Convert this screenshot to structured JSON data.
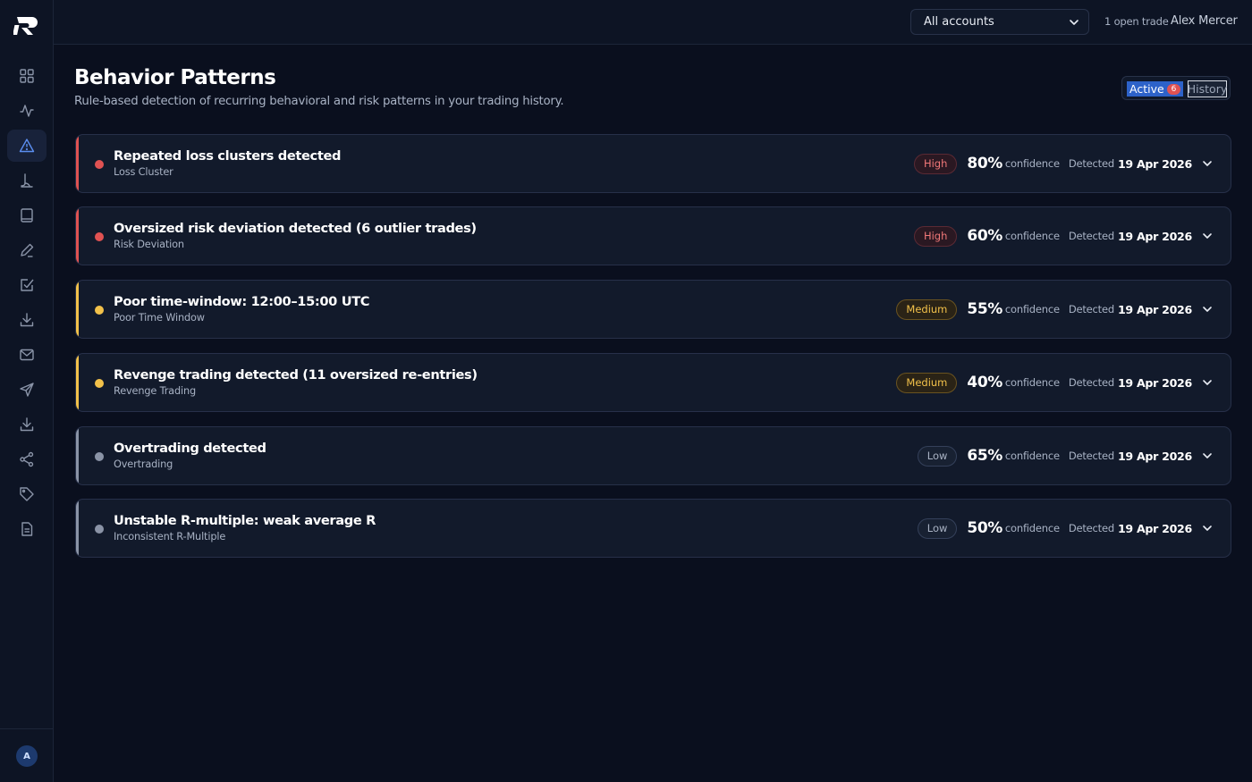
{
  "colors": {
    "high": "#e05252",
    "medium": "#f2c14a",
    "low": "#8a93a6",
    "accent": "#2d62c9"
  },
  "sidebar": {
    "logo": "R",
    "items": [
      {
        "icon": "dashboard-grid-icon",
        "active": false
      },
      {
        "icon": "activity-pulse-icon",
        "active": false
      },
      {
        "icon": "warning-triangle-icon",
        "active": true
      },
      {
        "icon": "lamp-icon",
        "active": false
      },
      {
        "icon": "book-icon",
        "active": false
      },
      {
        "icon": "pen-icon",
        "active": false
      },
      {
        "icon": "checkbox-icon",
        "active": false
      },
      {
        "icon": "download-icon",
        "active": false
      },
      {
        "icon": "mail-icon",
        "active": false
      },
      {
        "icon": "send-icon",
        "active": false
      },
      {
        "icon": "import-icon",
        "active": false
      },
      {
        "icon": "share-icon",
        "active": false
      },
      {
        "icon": "tag-icon",
        "active": false
      },
      {
        "icon": "document-icon",
        "active": false
      }
    ],
    "avatar_initial": "A"
  },
  "topbar": {
    "account_select": "All accounts",
    "open_trade": "1 open trade",
    "user_name": "Alex Mercer"
  },
  "header": {
    "title": "Behavior Patterns",
    "subtitle": "Rule-based detection of recurring behavioral and risk patterns in your trading history.",
    "toggle": {
      "active_label": "Active",
      "active_count": "6",
      "history_label": "History"
    }
  },
  "patterns": [
    {
      "title": "Repeated loss clusters detected",
      "category": "Loss Cluster",
      "severity": "High",
      "severity_key": "high",
      "confidence": "80%",
      "confidence_label": "confidence",
      "detected_label": "Detected",
      "detected_date": "19 Apr 2026"
    },
    {
      "title": "Oversized risk deviation detected (6 outlier trades)",
      "category": "Risk Deviation",
      "severity": "High",
      "severity_key": "high",
      "confidence": "60%",
      "confidence_label": "confidence",
      "detected_label": "Detected",
      "detected_date": "19 Apr 2026"
    },
    {
      "title": "Poor time-window: 12:00–15:00 UTC",
      "category": "Poor Time Window",
      "severity": "Medium",
      "severity_key": "medium",
      "confidence": "55%",
      "confidence_label": "confidence",
      "detected_label": "Detected",
      "detected_date": "19 Apr 2026"
    },
    {
      "title": "Revenge trading detected (11 oversized re-entries)",
      "category": "Revenge Trading",
      "severity": "Medium",
      "severity_key": "medium",
      "confidence": "40%",
      "confidence_label": "confidence",
      "detected_label": "Detected",
      "detected_date": "19 Apr 2026"
    },
    {
      "title": "Overtrading detected",
      "category": "Overtrading",
      "severity": "Low",
      "severity_key": "low",
      "confidence": "65%",
      "confidence_label": "confidence",
      "detected_label": "Detected",
      "detected_date": "19 Apr 2026"
    },
    {
      "title": "Unstable R-multiple: weak average R",
      "category": "Inconsistent R-Multiple",
      "severity": "Low",
      "severity_key": "low",
      "confidence": "50%",
      "confidence_label": "confidence",
      "detected_label": "Detected",
      "detected_date": "19 Apr 2026"
    }
  ]
}
